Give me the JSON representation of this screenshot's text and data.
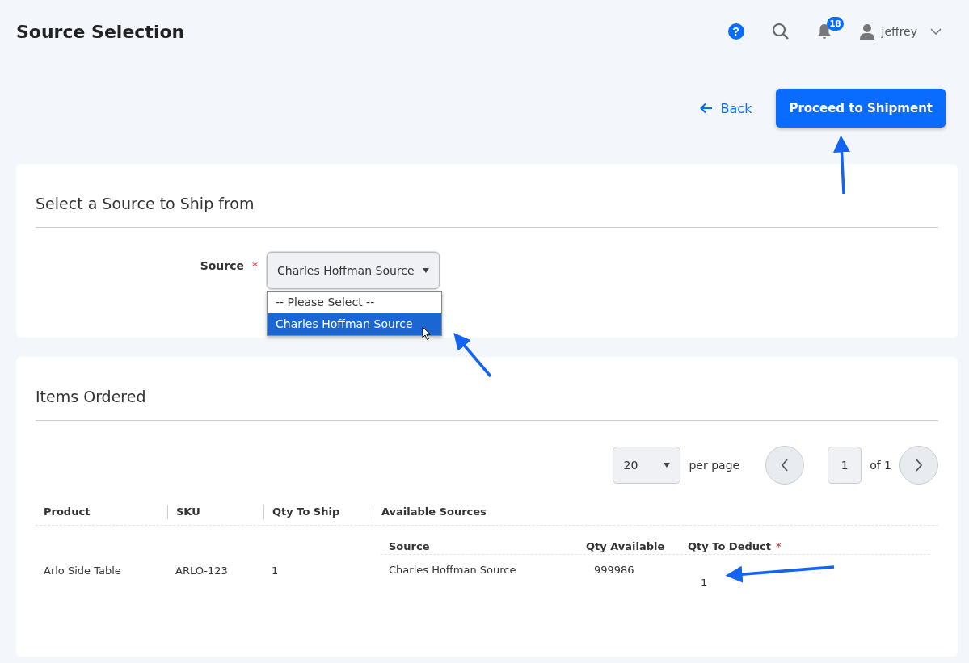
{
  "header": {
    "title": "Source Selection",
    "help": "?",
    "notifications_count": "18",
    "user": "jeffrey"
  },
  "actions": {
    "back": "Back",
    "proceed": "Proceed to Shipment"
  },
  "source_section": {
    "title": "Select a Source to Ship from",
    "field": {
      "label": "Source",
      "required_mark": "*",
      "value": "Charles Hoffman Source",
      "expanded": true,
      "options": [
        {
          "label": "-- Please Select --",
          "selected": false
        },
        {
          "label": "Charles Hoffman Source",
          "selected": true
        }
      ]
    }
  },
  "items_section": {
    "title": "Items Ordered",
    "pager": {
      "per_page_value": "20",
      "per_page_label": "per page",
      "page": "1",
      "of": "of 1"
    },
    "table": {
      "columns": [
        "Product",
        "SKU",
        "Qty To Ship",
        "Available Sources"
      ],
      "sub_columns": [
        {
          "label": "Source"
        },
        {
          "label": "Qty Available"
        },
        {
          "label": "Qty To Deduct",
          "required_mark": "*"
        }
      ],
      "rows": [
        {
          "product": "Arlo Side Table",
          "sku": "ARLO-123",
          "qty_to_ship": "1",
          "sources": [
            {
              "source": "Charles Hoffman Source",
              "qty_available": "999986",
              "qty_to_deduct": "1"
            }
          ]
        }
      ]
    }
  }
}
